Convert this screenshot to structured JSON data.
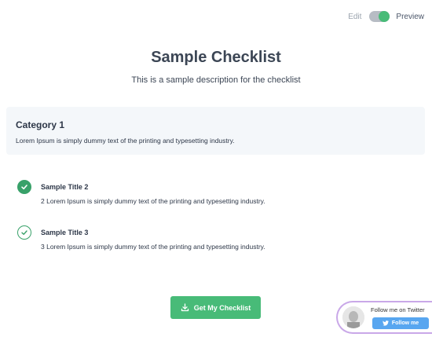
{
  "topbar": {
    "edit_label": "Edit",
    "preview_label": "Preview"
  },
  "checklist": {
    "title": "Sample Checklist",
    "description": "This is a sample description for the checklist"
  },
  "category": {
    "title": "Category 1",
    "text": "Lorem Ipsum is simply dummy text of the printing and typesetting industry."
  },
  "items": [
    {
      "title": "Sample Title 2",
      "text": "2 Lorem Ipsum is simply dummy text of the printing and typesetting industry.",
      "checked": true
    },
    {
      "title": "Sample Title 3",
      "text": "3 Lorem Ipsum is simply dummy text of the printing and typesetting industry.",
      "checked": false
    }
  ],
  "cta": {
    "label": "Get My Checklist"
  },
  "twitter": {
    "label": "Follow me on Twitter",
    "button_label": "Follow me"
  },
  "colors": {
    "accent": "#48bb78",
    "check": "#38a169",
    "twitter": "#58a6f0",
    "border": "#c9a8e8"
  }
}
